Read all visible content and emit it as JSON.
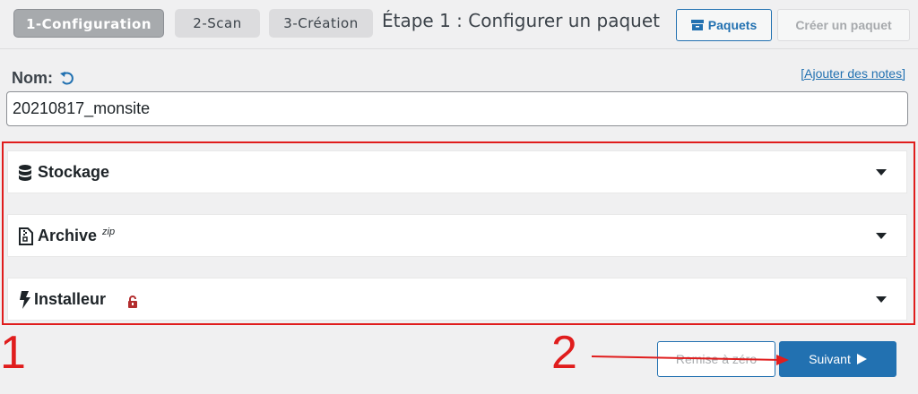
{
  "steps": [
    {
      "label": "1-Configuration"
    },
    {
      "label": "2-Scan"
    },
    {
      "label": "3-Création"
    }
  ],
  "header": {
    "title": "Étape 1 : Configurer un paquet",
    "paquets_label": "Paquets",
    "creer_label": "Créer un paquet"
  },
  "name_field": {
    "label": "Nom:",
    "value": "20210817_monsite",
    "add_notes_link": "[Ajouter des notes]"
  },
  "panels": [
    {
      "title": "Stockage",
      "icon": "database-icon"
    },
    {
      "title": "Archive",
      "sup": "zip",
      "icon": "file-zip-icon"
    },
    {
      "title": "Installeur",
      "icon": "bolt-icon",
      "badge_icon": "unlock-icon"
    }
  ],
  "annotations": {
    "one": "1",
    "two": "2"
  },
  "footer": {
    "reset_label": "Remise à zéro",
    "next_label": "Suivant"
  },
  "colors": {
    "accent": "#2271b1",
    "annotation": "#e01d1d",
    "lock": "#b32d2e"
  }
}
